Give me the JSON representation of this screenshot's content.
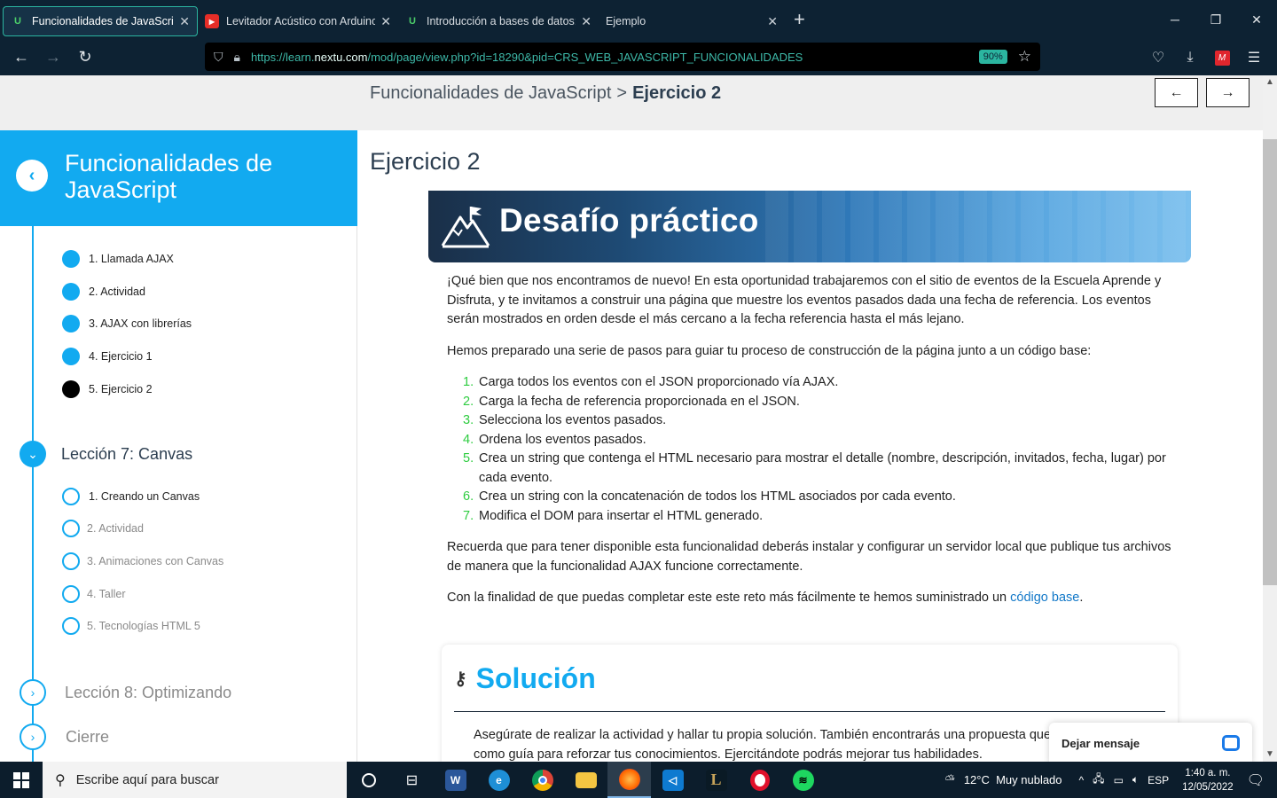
{
  "browser": {
    "tabs": [
      {
        "title": "Funcionalidades de JavaScript | N",
        "favicon": "u-icon",
        "active": true
      },
      {
        "title": "Levitador Acústico con Arduino",
        "favicon": "youtube-icon",
        "active": false
      },
      {
        "title": "Introducción a bases de datos: F",
        "favicon": "u-icon",
        "active": false
      },
      {
        "title": "Ejemplo",
        "favicon": "",
        "active": false
      }
    ],
    "url_prefix": "https://learn.",
    "url_domain": "nextu.com",
    "url_rest": "/mod/page/view.php?id=18290&pid=CRS_WEB_JAVASCRIPT_FUNCIONALIDADES",
    "zoom": "90%"
  },
  "breadcrumb": {
    "course": "Funcionalidades de JavaScript",
    "separator": ">",
    "current": "Ejercicio 2"
  },
  "pager": {
    "prev": "←",
    "next": "→"
  },
  "sidebar": {
    "title": "Funcionalidades de JavaScript",
    "lesson6_items": [
      {
        "label": "1. Llamada AJAX",
        "state": "done"
      },
      {
        "label": "2. Actividad",
        "state": "done"
      },
      {
        "label": "3. AJAX con librerías",
        "state": "done"
      },
      {
        "label": "4. Ejercicio 1",
        "state": "done"
      },
      {
        "label": "5. Ejercicio 2",
        "state": "current"
      }
    ],
    "lesson7": {
      "title": "Lección 7: Canvas",
      "items": [
        {
          "label": "1. Creando un Canvas",
          "state": "next"
        },
        {
          "label": "2. Actividad",
          "state": "pending"
        },
        {
          "label": "3. Animaciones con Canvas",
          "state": "pending"
        },
        {
          "label": "4. Taller",
          "state": "pending"
        },
        {
          "label": "5. Tecnologías HTML 5",
          "state": "pending"
        }
      ]
    },
    "lesson8": {
      "title": "Lección 8: Optimizando"
    },
    "closing": {
      "title": "Cierre"
    }
  },
  "main": {
    "heading": "Ejercicio 2",
    "banner_title": "Desafío práctico",
    "intro": "¡Qué bien que nos encontramos de nuevo! En esta oportunidad trabajaremos con el sitio de eventos de la Escuela Aprende y Disfruta, y te invitamos a construir una página que muestre los eventos pasados dada una fecha de referencia. Los eventos serán mostrados en orden desde el más cercano a la fecha referencia hasta el más lejano.",
    "steps_intro": "Hemos preparado una serie de pasos para guiar tu proceso de construcción de la página junto a un código base:",
    "steps": [
      "Carga todos los eventos con el JSON proporcionado vía AJAX.",
      "Carga la fecha de referencia proporcionada en el JSON.",
      "Selecciona los eventos pasados.",
      "Ordena los eventos pasados.",
      "Crea un string que contenga el HTML necesario para mostrar el detalle (nombre, descripción, invitados, fecha, lugar) por cada evento.",
      "Crea un string con la concatenación de todos los HTML asociados por cada evento.",
      "Modifica el DOM para insertar el HTML generado."
    ],
    "reminder": "Recuerda que para tener disponible esta funcionalidad deberás instalar y configurar un servidor local que publique tus archivos de manera que la funcionalidad AJAX funcione correctamente.",
    "base_text": "Con la finalidad de que puedas completar este este reto más fácilmente te hemos suministrado un ",
    "base_link": "código base",
    "base_end": ".",
    "solution_title": "Solución",
    "solution_text": "Asegúrate de realizar la actividad y hallar tu propia solución. También encontrarás una propuesta que te ofrecemos como guía para reforzar tus conocimientos. Ejercitándote podrás mejorar tus habilidades."
  },
  "chat": {
    "label": "Dejar mensaje"
  },
  "taskbar": {
    "search_placeholder": "Escribe aquí para buscar",
    "weather": "12°C  Muy nublado",
    "lang": "ESP",
    "time": "1:40 a. m.",
    "date": "12/05/2022"
  },
  "colors": {
    "accent": "#12aaf0",
    "step_number": "#2ecc40",
    "link": "#1278c8"
  }
}
